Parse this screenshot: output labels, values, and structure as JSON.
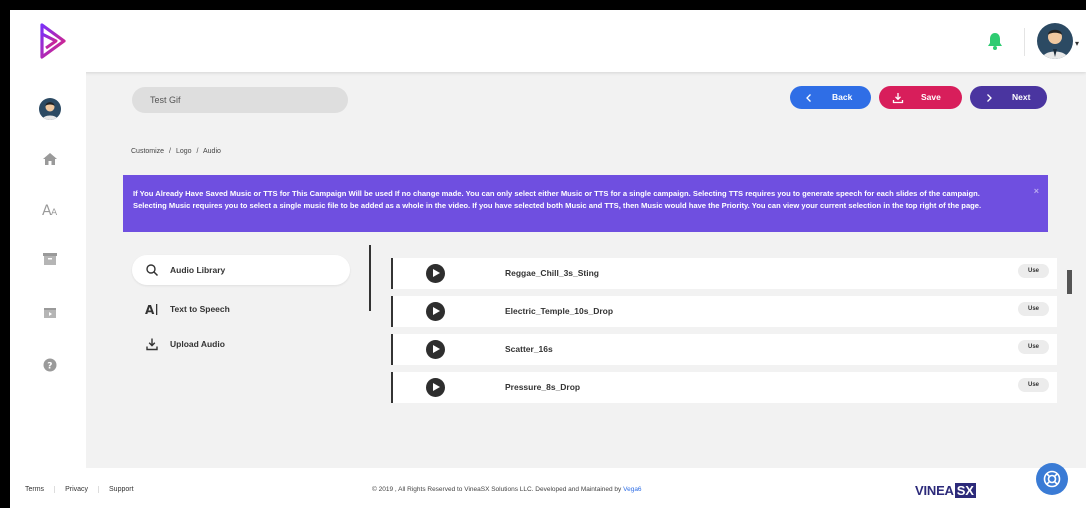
{
  "campaign": {
    "name": "Test Gif"
  },
  "actions": {
    "back": "Back",
    "save": "Save",
    "next": "Next"
  },
  "breadcrumb": {
    "customize": "Customize",
    "sep1": "/",
    "logo": "Logo",
    "sep2": "/",
    "audio": "Audio"
  },
  "alert": {
    "text": "If You Already Have Saved Music or TTS for This Campaign Will be used If no change made. You can only select either Music or TTS for a single campaign. Selecting TTS requires you to generate speech for each slides of the campaign. Selecting Music requires you to select a single music file to be added as a whole in the video. If you have selected both Music and TTS, then Music would have the Priority. You can view your current selection in the top right of the page.",
    "close": "×"
  },
  "tabs": [
    {
      "label": "Audio Library",
      "icon": "search-icon",
      "active": true
    },
    {
      "label": "Text to Speech",
      "icon": "text-to-speech-icon",
      "active": false
    },
    {
      "label": "Upload Audio",
      "icon": "upload-icon",
      "active": false
    }
  ],
  "tracks": [
    {
      "name": "Reggae_Chill_3s_Sting",
      "use": "Use"
    },
    {
      "name": "Electric_Temple_10s_Drop",
      "use": "Use"
    },
    {
      "name": "Scatter_16s",
      "use": "Use"
    },
    {
      "name": "Pressure_8s_Drop",
      "use": "Use"
    }
  ],
  "footer": {
    "terms": "Terms",
    "privacy": "Privacy",
    "support": "Support",
    "copyright": "© 2019 , All Rights Reserved to VineaSX Solutions LLC. Developed and Maintained by",
    "developer": "Vega6",
    "brand_main": "VINEA",
    "brand_sx": "SX"
  },
  "colors": {
    "back": "#2f6ee6",
    "save": "#d81e5b",
    "next": "#4a35a0",
    "alert": "#6f4fe0",
    "bell": "#2ecc71"
  }
}
